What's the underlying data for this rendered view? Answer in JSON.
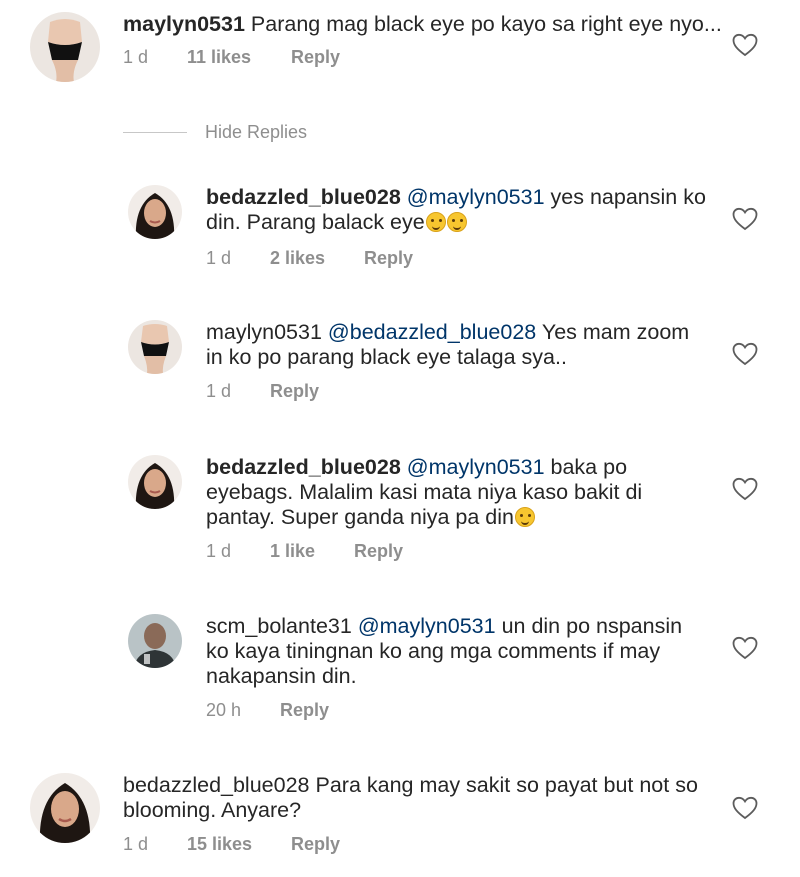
{
  "comments": [
    {
      "username": "maylyn0531",
      "mention": "",
      "text": "Parang mag black eye po kayo sa right eye nyo...",
      "time": "1 d",
      "likes": "11 likes",
      "reply_label": "Reply",
      "avatar": "avatar-woman-black-outfit",
      "emojis": []
    },
    {
      "username": "bedazzled_blue028",
      "mention": "@maylyn0531",
      "text": "yes napansin ko din. Parang balack eye",
      "time": "1 d",
      "likes": "2 likes",
      "reply_label": "Reply",
      "avatar": "avatar-woman-portrait",
      "emojis": [
        "thinking-face",
        "thinking-face"
      ]
    },
    {
      "username": "maylyn0531",
      "mention": "@bedazzled_blue028",
      "text": "Yes mam zoom in ko po parang black eye talaga sya..",
      "time": "1 d",
      "likes": "",
      "reply_label": "Reply",
      "avatar": "avatar-woman-black-outfit",
      "emojis": []
    },
    {
      "username": "bedazzled_blue028",
      "mention": "@maylyn0531",
      "text": "baka po eyebags. Malalim kasi mata niya kaso bakit di pantay. Super ganda niya pa din",
      "time": "1 d",
      "likes": "1 like",
      "reply_label": "Reply",
      "avatar": "avatar-woman-portrait",
      "emojis": [
        "smiling-face"
      ]
    },
    {
      "username": "scm_bolante31",
      "mention": "@maylyn0531",
      "text": "un din po nspansin ko kaya tiningnan ko ang mga comments if may nakapansin din.",
      "time": "20 h",
      "likes": "",
      "reply_label": "Reply",
      "avatar": "avatar-man-portrait",
      "emojis": []
    },
    {
      "username": "bedazzled_blue028",
      "mention": "",
      "text": "Para kang may sakit so payat but not so blooming. Anyare?",
      "time": "1 d",
      "likes": "15 likes",
      "reply_label": "Reply",
      "avatar": "avatar-woman-portrait",
      "emojis": []
    }
  ],
  "hide_replies_label": "Hide Replies",
  "colors": {
    "text": "#262626",
    "muted": "#8e8e8e",
    "mention": "#003569"
  }
}
